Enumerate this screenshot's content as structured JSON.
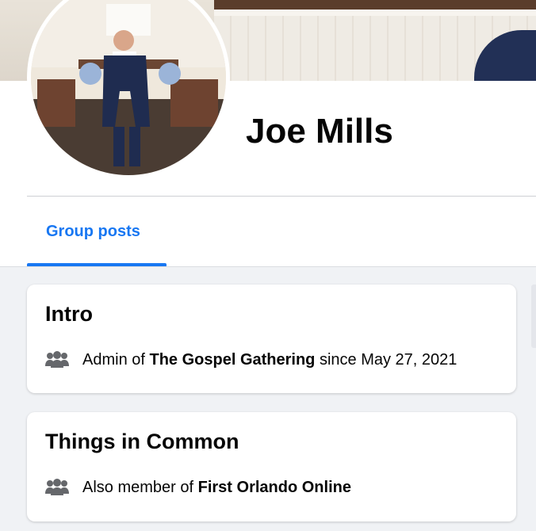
{
  "profile": {
    "name": "Joe Mills"
  },
  "tabs": [
    {
      "label": "Group posts",
      "active": true
    }
  ],
  "intro": {
    "title": "Intro",
    "line": {
      "prefix": "Admin of ",
      "group": "The Gospel Gathering",
      "suffix": " since May 27, 2021",
      "icon": "group-icon"
    }
  },
  "common": {
    "title": "Things in Common",
    "line": {
      "prefix": "Also member of ",
      "group": "First Orlando Online",
      "icon": "group-icon"
    }
  },
  "colors": {
    "accent": "#1877f2",
    "page_bg": "#f0f2f5",
    "icon_gray": "#65676b"
  }
}
